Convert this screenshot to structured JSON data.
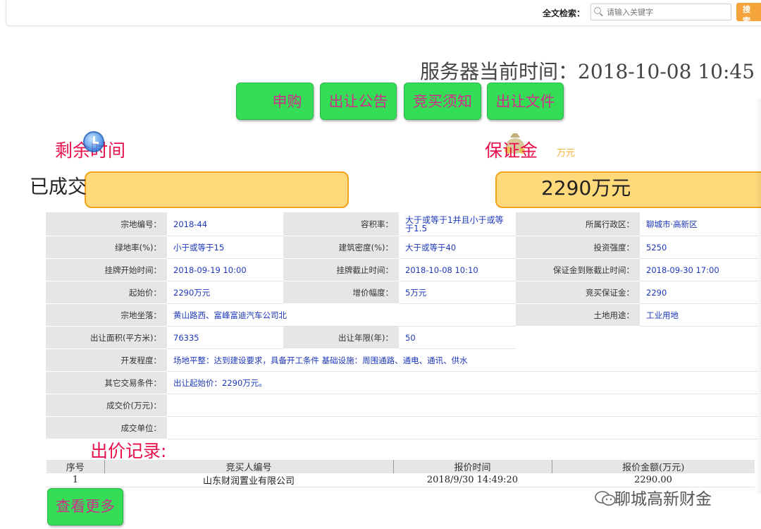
{
  "search": {
    "label": "全文检索：",
    "placeholder": "请输入关键字",
    "button_label": "搜 索"
  },
  "server_time": "服务器当前时间：2018-10-08 10:45",
  "actions": [
    {
      "label": "申购"
    },
    {
      "label": "出让公告"
    },
    {
      "label": "竞买须知"
    },
    {
      "label": "出让文件"
    }
  ],
  "countdown": {
    "label": "剩余时间",
    "status": "已成交"
  },
  "deposit": {
    "label": "保证金",
    "unit": "万元",
    "value": "2290万元"
  },
  "info": {
    "row1": [
      "宗地编号：",
      "2018-44",
      "容积率：",
      "大于或等于1并且小于或等于1.5",
      "所属行政区：",
      "聊城市·高新区"
    ],
    "row2": [
      "绿地率(%)：",
      "小于或等于15",
      "建筑密度(%)：",
      "大于或等于40",
      "投资强度：",
      "5250"
    ],
    "row3": [
      "挂牌开始时间：",
      "2018-09-19 10:00",
      "挂牌截止时间：",
      "2018-10-08 10:10",
      "保证金到账截止时间：",
      "2018-09-30 17:00"
    ],
    "row4": [
      "起始价：",
      "2290万元",
      "增价幅度：",
      "5万元",
      "竞买保证金：",
      "2290"
    ],
    "row5": [
      "宗地坐落：",
      "黄山路西、富峰富迪汽车公司北",
      "土地用途：",
      "工业用地"
    ],
    "row6": [
      "出让面积(平方米)：",
      "76335",
      "出让年限(年)：",
      "50"
    ],
    "row7": [
      "开发程度：",
      "场地平整：达到建设要求，具备开工条件 基础设施：周围通路、通电、通讯、供水"
    ],
    "row8": [
      "其它交易条件：",
      "出让起始价：2290万元。"
    ],
    "row9": [
      "成交价(万元)：",
      ""
    ],
    "row10": [
      "成交单位：",
      ""
    ]
  },
  "bids": {
    "title": "出价记录:",
    "headers": [
      "序号",
      "竞买人编号",
      "报价时间",
      "报价金额(万元)"
    ],
    "rows": [
      [
        "1",
        "山东财润置业有限公司",
        "2018/9/30 14:49:20",
        "2290.00"
      ]
    ],
    "more_label": "查看更多"
  },
  "watermark": "聊城高新财金",
  "colors": {
    "button_green": "#33dd55",
    "button_text": "#d02d8c",
    "label_red": "#e8104a",
    "panel_fill": "#ffd97a",
    "panel_border": "#f2a21c",
    "value_blue": "#1c37b8",
    "search_button": "#f4a43a"
  },
  "icons": [
    "search-icon",
    "clock-icon",
    "money-bag-icon",
    "wechat-icon"
  ]
}
